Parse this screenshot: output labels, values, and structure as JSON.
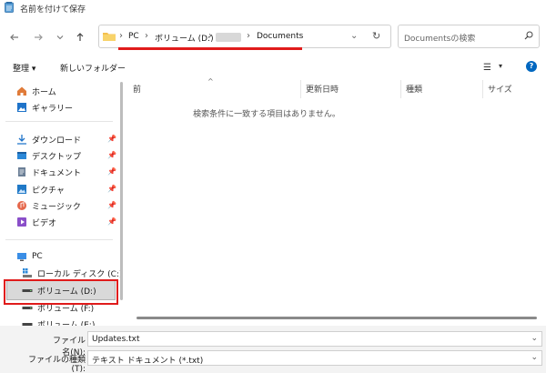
{
  "window": {
    "title": "名前を付けて保存"
  },
  "nav": {
    "back_icon": "back-arrow-icon",
    "forward_icon": "forward-arrow-icon",
    "recent_icon": "chevron-down-icon",
    "up_icon": "up-arrow-icon"
  },
  "address": {
    "sep": "›",
    "pc": "PC",
    "volume": "ボリューム (D:)",
    "current": "Documents",
    "dropdown": "⌄",
    "refresh": "↻"
  },
  "search": {
    "placeholder": "Documentsの検索"
  },
  "toolbar": {
    "organize": "整理 ▾",
    "new_folder": "新しいフォルダー",
    "view_icon": "☰",
    "view_dd": "▾",
    "help": "?"
  },
  "sidebar": {
    "quick": [
      {
        "label": "ホーム",
        "icon": "home-icon",
        "pinned": false
      },
      {
        "label": "ギャラリー",
        "icon": "gallery-icon",
        "pinned": false
      }
    ],
    "pinned": [
      {
        "label": "ダウンロード",
        "icon": "download-icon"
      },
      {
        "label": "デスクトップ",
        "icon": "desktop-icon"
      },
      {
        "label": "ドキュメント",
        "icon": "documents-icon"
      },
      {
        "label": "ピクチャ",
        "icon": "pictures-icon"
      },
      {
        "label": "ミュージック",
        "icon": "music-icon"
      },
      {
        "label": "ビデオ",
        "icon": "videos-icon"
      }
    ],
    "pin_glyph": "📌",
    "drives": [
      {
        "label": "PC",
        "icon": "pc-icon"
      },
      {
        "label": "ローカル ディスク (C:)",
        "icon": "disk-icon"
      },
      {
        "label": "ボリューム (D:)",
        "icon": "drive-icon",
        "selected": true
      },
      {
        "label": "ボリューム (F:)",
        "icon": "drive-icon"
      },
      {
        "label": "ボリューム (E:)",
        "icon": "drive-icon"
      }
    ]
  },
  "columns": {
    "name": "前",
    "modified": "更新日時",
    "type": "種類",
    "size": "サイズ"
  },
  "empty_message": "検索条件に一致する項目はありません。",
  "footer": {
    "filename_label": "ファイル名(N):",
    "filename_value": "Updates.txt",
    "filetype_label": "ファイルの種類(T):",
    "filetype_value": "テキスト ドキュメント (*.txt)"
  },
  "colors": {
    "accent": "#0067c0",
    "highlight": "#e01b1b",
    "selected_bg": "#d9d9d9"
  }
}
